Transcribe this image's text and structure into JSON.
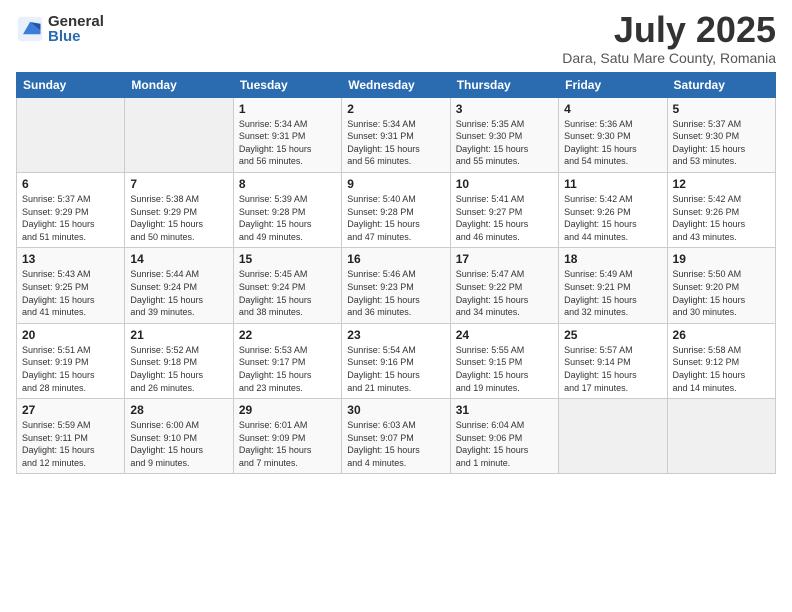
{
  "header": {
    "logo_general": "General",
    "logo_blue": "Blue",
    "month_year": "July 2025",
    "location": "Dara, Satu Mare County, Romania"
  },
  "weekdays": [
    "Sunday",
    "Monday",
    "Tuesday",
    "Wednesday",
    "Thursday",
    "Friday",
    "Saturday"
  ],
  "weeks": [
    [
      {
        "day": "",
        "detail": ""
      },
      {
        "day": "",
        "detail": ""
      },
      {
        "day": "1",
        "detail": "Sunrise: 5:34 AM\nSunset: 9:31 PM\nDaylight: 15 hours\nand 56 minutes."
      },
      {
        "day": "2",
        "detail": "Sunrise: 5:34 AM\nSunset: 9:31 PM\nDaylight: 15 hours\nand 56 minutes."
      },
      {
        "day": "3",
        "detail": "Sunrise: 5:35 AM\nSunset: 9:30 PM\nDaylight: 15 hours\nand 55 minutes."
      },
      {
        "day": "4",
        "detail": "Sunrise: 5:36 AM\nSunset: 9:30 PM\nDaylight: 15 hours\nand 54 minutes."
      },
      {
        "day": "5",
        "detail": "Sunrise: 5:37 AM\nSunset: 9:30 PM\nDaylight: 15 hours\nand 53 minutes."
      }
    ],
    [
      {
        "day": "6",
        "detail": "Sunrise: 5:37 AM\nSunset: 9:29 PM\nDaylight: 15 hours\nand 51 minutes."
      },
      {
        "day": "7",
        "detail": "Sunrise: 5:38 AM\nSunset: 9:29 PM\nDaylight: 15 hours\nand 50 minutes."
      },
      {
        "day": "8",
        "detail": "Sunrise: 5:39 AM\nSunset: 9:28 PM\nDaylight: 15 hours\nand 49 minutes."
      },
      {
        "day": "9",
        "detail": "Sunrise: 5:40 AM\nSunset: 9:28 PM\nDaylight: 15 hours\nand 47 minutes."
      },
      {
        "day": "10",
        "detail": "Sunrise: 5:41 AM\nSunset: 9:27 PM\nDaylight: 15 hours\nand 46 minutes."
      },
      {
        "day": "11",
        "detail": "Sunrise: 5:42 AM\nSunset: 9:26 PM\nDaylight: 15 hours\nand 44 minutes."
      },
      {
        "day": "12",
        "detail": "Sunrise: 5:42 AM\nSunset: 9:26 PM\nDaylight: 15 hours\nand 43 minutes."
      }
    ],
    [
      {
        "day": "13",
        "detail": "Sunrise: 5:43 AM\nSunset: 9:25 PM\nDaylight: 15 hours\nand 41 minutes."
      },
      {
        "day": "14",
        "detail": "Sunrise: 5:44 AM\nSunset: 9:24 PM\nDaylight: 15 hours\nand 39 minutes."
      },
      {
        "day": "15",
        "detail": "Sunrise: 5:45 AM\nSunset: 9:24 PM\nDaylight: 15 hours\nand 38 minutes."
      },
      {
        "day": "16",
        "detail": "Sunrise: 5:46 AM\nSunset: 9:23 PM\nDaylight: 15 hours\nand 36 minutes."
      },
      {
        "day": "17",
        "detail": "Sunrise: 5:47 AM\nSunset: 9:22 PM\nDaylight: 15 hours\nand 34 minutes."
      },
      {
        "day": "18",
        "detail": "Sunrise: 5:49 AM\nSunset: 9:21 PM\nDaylight: 15 hours\nand 32 minutes."
      },
      {
        "day": "19",
        "detail": "Sunrise: 5:50 AM\nSunset: 9:20 PM\nDaylight: 15 hours\nand 30 minutes."
      }
    ],
    [
      {
        "day": "20",
        "detail": "Sunrise: 5:51 AM\nSunset: 9:19 PM\nDaylight: 15 hours\nand 28 minutes."
      },
      {
        "day": "21",
        "detail": "Sunrise: 5:52 AM\nSunset: 9:18 PM\nDaylight: 15 hours\nand 26 minutes."
      },
      {
        "day": "22",
        "detail": "Sunrise: 5:53 AM\nSunset: 9:17 PM\nDaylight: 15 hours\nand 23 minutes."
      },
      {
        "day": "23",
        "detail": "Sunrise: 5:54 AM\nSunset: 9:16 PM\nDaylight: 15 hours\nand 21 minutes."
      },
      {
        "day": "24",
        "detail": "Sunrise: 5:55 AM\nSunset: 9:15 PM\nDaylight: 15 hours\nand 19 minutes."
      },
      {
        "day": "25",
        "detail": "Sunrise: 5:57 AM\nSunset: 9:14 PM\nDaylight: 15 hours\nand 17 minutes."
      },
      {
        "day": "26",
        "detail": "Sunrise: 5:58 AM\nSunset: 9:12 PM\nDaylight: 15 hours\nand 14 minutes."
      }
    ],
    [
      {
        "day": "27",
        "detail": "Sunrise: 5:59 AM\nSunset: 9:11 PM\nDaylight: 15 hours\nand 12 minutes."
      },
      {
        "day": "28",
        "detail": "Sunrise: 6:00 AM\nSunset: 9:10 PM\nDaylight: 15 hours\nand 9 minutes."
      },
      {
        "day": "29",
        "detail": "Sunrise: 6:01 AM\nSunset: 9:09 PM\nDaylight: 15 hours\nand 7 minutes."
      },
      {
        "day": "30",
        "detail": "Sunrise: 6:03 AM\nSunset: 9:07 PM\nDaylight: 15 hours\nand 4 minutes."
      },
      {
        "day": "31",
        "detail": "Sunrise: 6:04 AM\nSunset: 9:06 PM\nDaylight: 15 hours\nand 1 minute."
      },
      {
        "day": "",
        "detail": ""
      },
      {
        "day": "",
        "detail": ""
      }
    ]
  ]
}
